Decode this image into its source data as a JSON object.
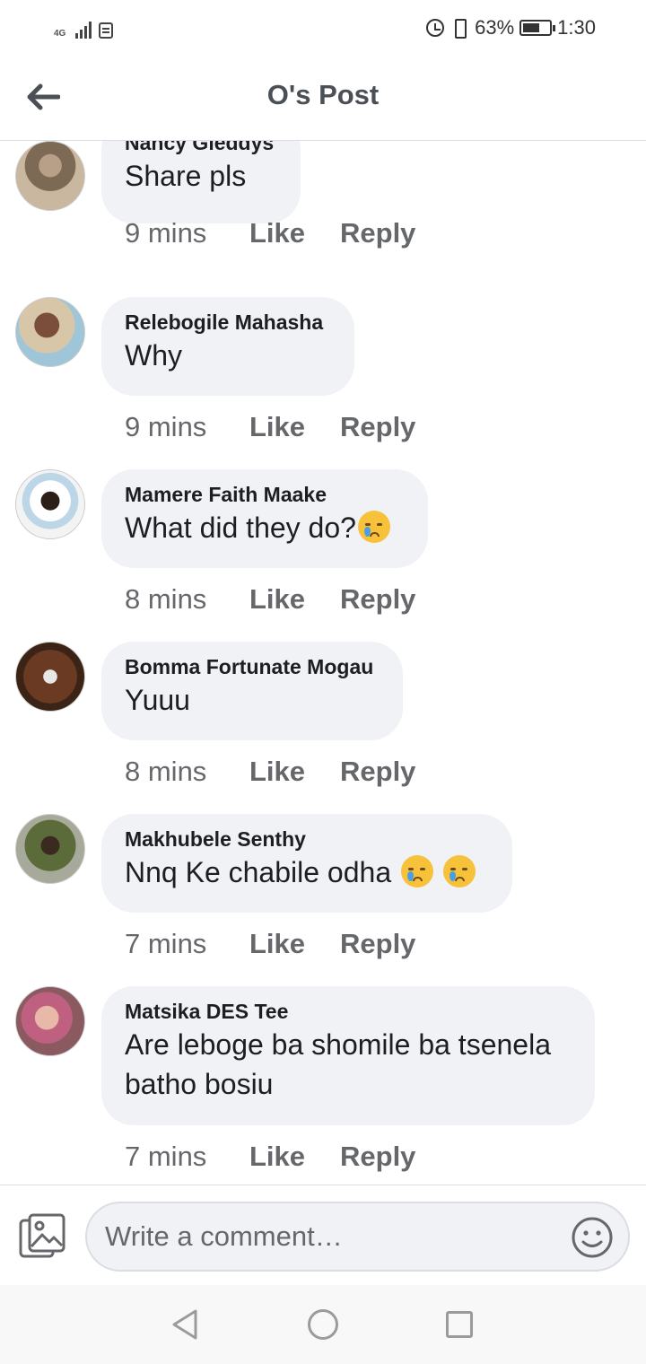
{
  "status_bar": {
    "network": "4G",
    "battery": "63%",
    "time": "1:30",
    "icons": [
      "signal-icon",
      "sim-icon",
      "alarm-icon",
      "vibrate-icon",
      "battery-icon"
    ]
  },
  "header": {
    "title": "O's Post",
    "back_icon": "arrow-left-icon"
  },
  "comments": [
    {
      "author": "Nancy Gleddys",
      "text": "Share pls",
      "time": "9 mins",
      "like": "Like",
      "reply": "Reply"
    },
    {
      "author": "Relebogile Mahasha",
      "text": "Why",
      "time": "9 mins",
      "like": "Like",
      "reply": "Reply"
    },
    {
      "author": "Mamere Faith Maake",
      "text": "What did they do?",
      "emoji": [
        "sleepy-face-emoji"
      ],
      "time": "8 mins",
      "like": "Like",
      "reply": "Reply"
    },
    {
      "author": "Bomma Fortunate Mogau",
      "text": "Yuuu",
      "time": "8 mins",
      "like": "Like",
      "reply": "Reply"
    },
    {
      "author": "Makhubele Senthy",
      "text": "Nnq Ke chabile odha ",
      "emoji": [
        "crying-face-emoji",
        "crying-face-emoji"
      ],
      "time": "7 mins",
      "like": "Like",
      "reply": "Reply"
    },
    {
      "author": "Matsika DES Tee",
      "text_lines": [
        "Are leboge ba shomile ba tsenela",
        "batho bosiu"
      ],
      "time": "7 mins",
      "like": "Like",
      "reply": "Reply"
    }
  ],
  "composer": {
    "placeholder": "Write a comment…",
    "photo_icon": "photo-icon",
    "emoji_icon": "smiley-icon"
  },
  "nav_bar": {
    "icons": [
      "nav-back-icon",
      "nav-home-icon",
      "nav-recents-icon"
    ]
  },
  "colors": {
    "bubble": "#f0f2f5",
    "meta_text": "#65676b",
    "title_text": "#4b4f56"
  }
}
